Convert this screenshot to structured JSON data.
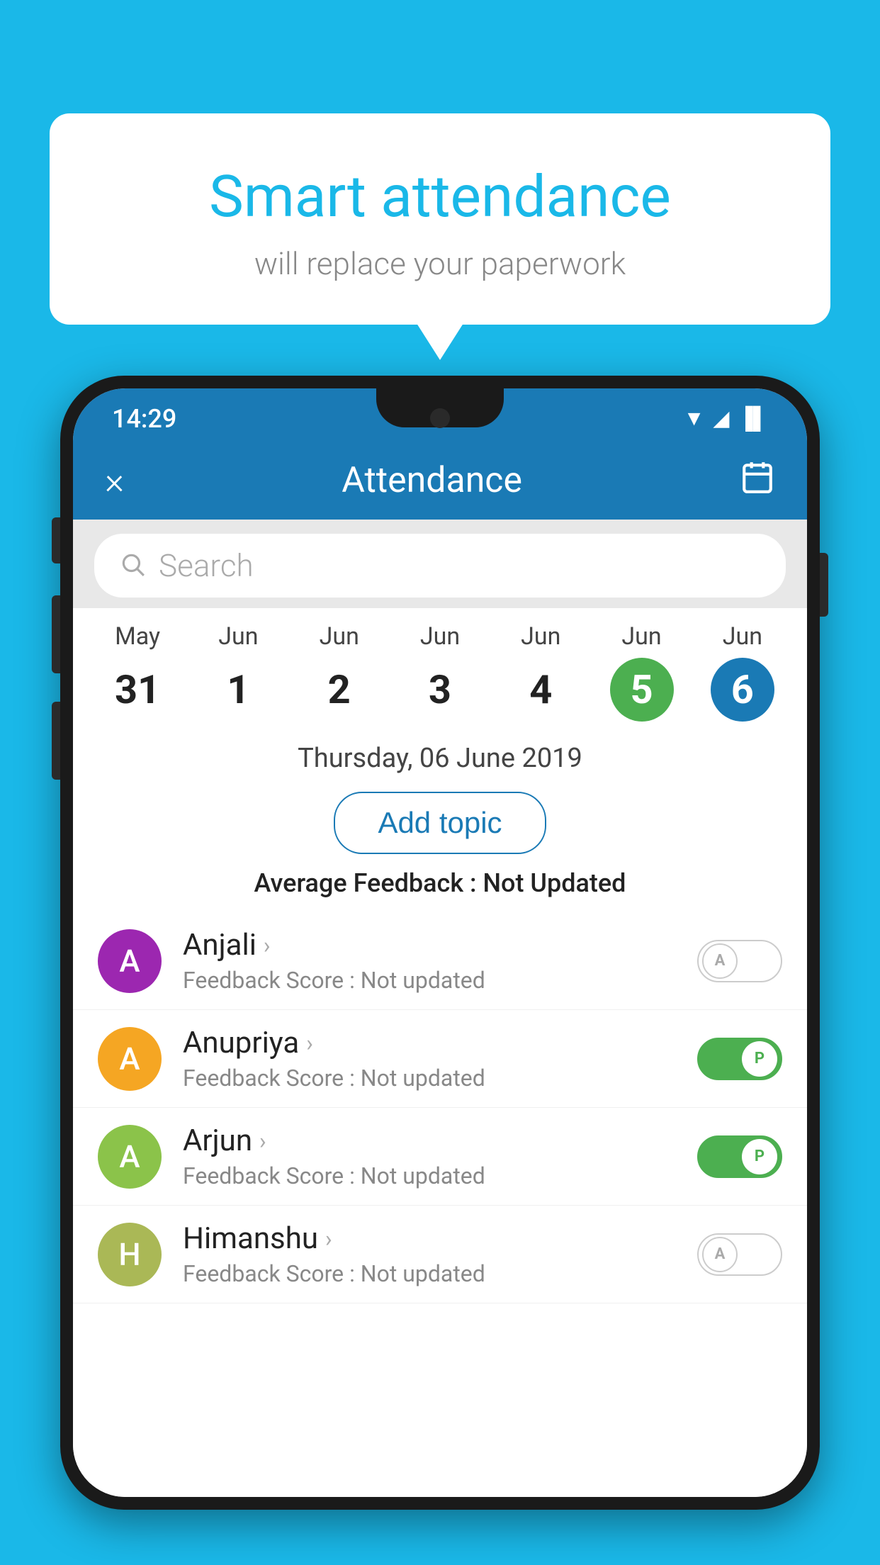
{
  "background_color": "#1ab8e8",
  "speech_bubble": {
    "title": "Smart attendance",
    "subtitle": "will replace your paperwork"
  },
  "status_bar": {
    "time": "14:29",
    "wifi": "▼",
    "signal": "▲",
    "battery": "▐"
  },
  "app_header": {
    "title": "Attendance",
    "close_label": "×",
    "calendar_icon": "📅"
  },
  "search": {
    "placeholder": "Search"
  },
  "calendar": {
    "days": [
      {
        "month": "May",
        "date": "31",
        "state": "normal"
      },
      {
        "month": "Jun",
        "date": "1",
        "state": "normal"
      },
      {
        "month": "Jun",
        "date": "2",
        "state": "normal"
      },
      {
        "month": "Jun",
        "date": "3",
        "state": "normal"
      },
      {
        "month": "Jun",
        "date": "4",
        "state": "normal"
      },
      {
        "month": "Jun",
        "date": "5",
        "state": "today"
      },
      {
        "month": "Jun",
        "date": "6",
        "state": "selected"
      }
    ]
  },
  "selected_date": "Thursday, 06 June 2019",
  "add_topic_label": "Add topic",
  "avg_feedback_prefix": "Average Feedback : ",
  "avg_feedback_value": "Not Updated",
  "students": [
    {
      "name": "Anjali",
      "avatar_letter": "A",
      "avatar_color": "#9c27b0",
      "feedback_prefix": "Feedback Score : ",
      "feedback_value": "Not updated",
      "toggle": "off",
      "toggle_letter": "A"
    },
    {
      "name": "Anupriya",
      "avatar_letter": "A",
      "avatar_color": "#f5a623",
      "feedback_prefix": "Feedback Score : ",
      "feedback_value": "Not updated",
      "toggle": "on",
      "toggle_letter": "P"
    },
    {
      "name": "Arjun",
      "avatar_letter": "A",
      "avatar_color": "#8bc34a",
      "feedback_prefix": "Feedback Score : ",
      "feedback_value": "Not updated",
      "toggle": "on",
      "toggle_letter": "P"
    },
    {
      "name": "Himanshu",
      "avatar_letter": "H",
      "avatar_color": "#aab856",
      "feedback_prefix": "Feedback Score : ",
      "feedback_value": "Not updated",
      "toggle": "off",
      "toggle_letter": "A"
    }
  ]
}
